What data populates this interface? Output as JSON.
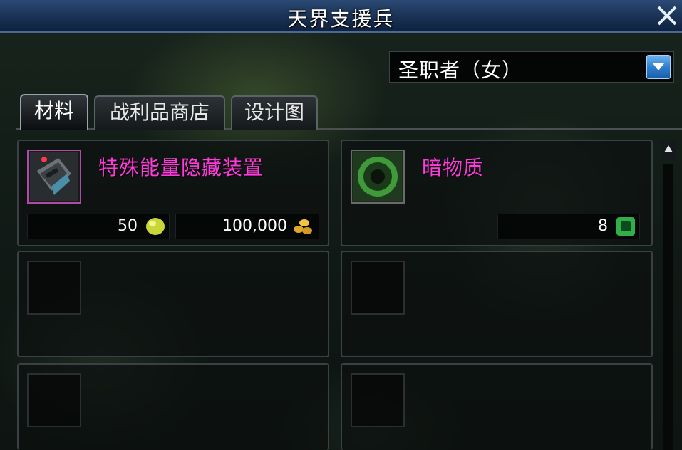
{
  "window": {
    "title": "天界支援兵"
  },
  "class_select": {
    "value": "圣职者（女）"
  },
  "tabs": [
    {
      "label": "材料",
      "active": true
    },
    {
      "label": "战利品商店",
      "active": false
    },
    {
      "label": "设计图",
      "active": false
    }
  ],
  "items": [
    {
      "name": "特殊能量隐藏装置",
      "name_color": "#ff3bdc",
      "icon": "energy-device-icon",
      "prices": [
        {
          "value": "50",
          "currency_icon": "yellow-gem-icon"
        },
        {
          "value": "100,000",
          "currency_icon": "gold-coins-icon"
        }
      ]
    },
    {
      "name": "暗物质",
      "name_color": "#ff3bdc",
      "icon": "dark-matter-icon",
      "prices": [
        {
          "value": "8",
          "currency_icon": "green-gem-icon"
        }
      ]
    }
  ],
  "colors": {
    "titlebar": "#1c3559",
    "item_name": "#ff3bdc",
    "dropdown_button": "#2f7fd0"
  }
}
